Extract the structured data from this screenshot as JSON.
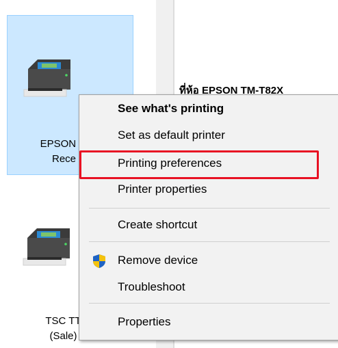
{
  "devices": [
    {
      "name_line1": "EPSON TI",
      "name_line2": "Rece"
    },
    {
      "name_line1": "TSC TT",
      "name_line2": "(Sale)"
    }
  ],
  "right_pane": {
    "heading_partial": "ที่ห้อ EPSON TM-T82X"
  },
  "context_menu": {
    "items": [
      {
        "label": "See what's printing",
        "bold": true
      },
      {
        "label": "Set as default printer"
      },
      {
        "label": "Printing preferences",
        "highlighted": true
      },
      {
        "label": "Printer properties"
      },
      {
        "label": "Create shortcut"
      },
      {
        "label": "Remove device",
        "icon": "shield-icon"
      },
      {
        "label": "Troubleshoot"
      },
      {
        "label": "Properties"
      }
    ]
  },
  "colors": {
    "selection_bg": "#cce8ff",
    "selection_border": "#99d1ff",
    "menu_bg": "#f2f2f2",
    "highlight_border": "#e81123"
  }
}
